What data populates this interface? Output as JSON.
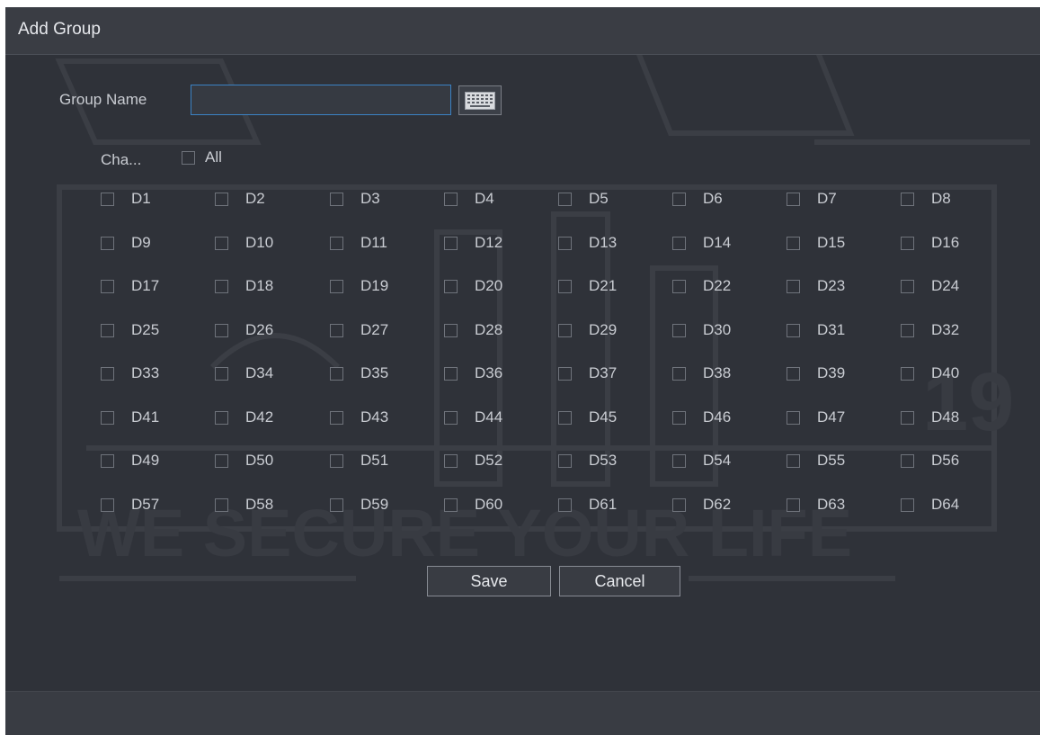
{
  "dialog": {
    "title": "Add Group"
  },
  "form": {
    "group_name_label": "Group Name",
    "group_name_value": "",
    "channels_label": "Cha...",
    "all_label": "All",
    "all_checked": false
  },
  "channels": [
    "D1",
    "D2",
    "D3",
    "D4",
    "D5",
    "D6",
    "D7",
    "D8",
    "D9",
    "D10",
    "D11",
    "D12",
    "D13",
    "D14",
    "D15",
    "D16",
    "D17",
    "D18",
    "D19",
    "D20",
    "D21",
    "D22",
    "D23",
    "D24",
    "D25",
    "D26",
    "D27",
    "D28",
    "D29",
    "D30",
    "D31",
    "D32",
    "D33",
    "D34",
    "D35",
    "D36",
    "D37",
    "D38",
    "D39",
    "D40",
    "D41",
    "D42",
    "D43",
    "D44",
    "D45",
    "D46",
    "D47",
    "D48",
    "D49",
    "D50",
    "D51",
    "D52",
    "D53",
    "D54",
    "D55",
    "D56",
    "D57",
    "D58",
    "D59",
    "D60",
    "D61",
    "D62",
    "D63",
    "D64"
  ],
  "buttons": {
    "save": "Save",
    "cancel": "Cancel"
  },
  "icons": {
    "keyboard": "keyboard-icon"
  },
  "colors": {
    "background": "#2f3239",
    "input_border": "#3b82c4",
    "text": "#c9ccd2"
  }
}
